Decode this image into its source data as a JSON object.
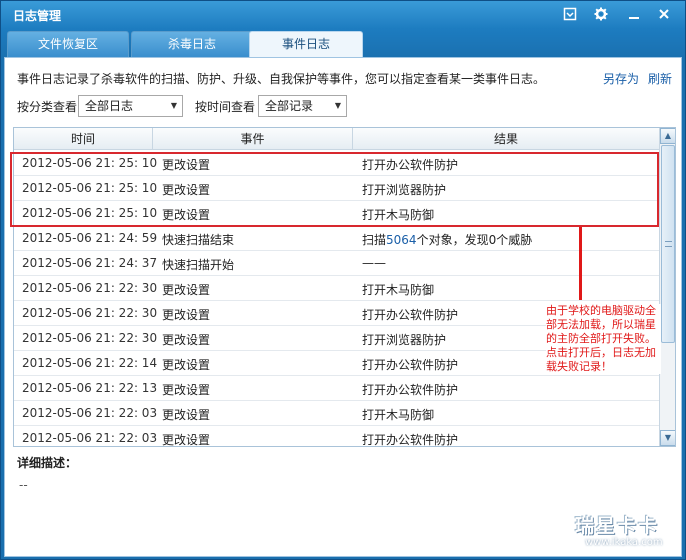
{
  "window": {
    "title": "日志管理"
  },
  "tabs": [
    {
      "label": "文件恢复区",
      "active": false
    },
    {
      "label": "杀毒日志",
      "active": false
    },
    {
      "label": "事件日志",
      "active": true
    }
  ],
  "header": {
    "description": "事件日志记录了杀毒软件的扫描、防护、升级、自我保护等事件，您可以指定查看某一类事件日志。",
    "save_as": "另存为",
    "refresh": "刷新"
  },
  "filters": {
    "category_label": "按分类查看",
    "category_value": "全部日志",
    "time_label": "按时间查看",
    "time_value": "全部记录"
  },
  "table": {
    "columns": [
      "时间",
      "事件",
      "结果"
    ],
    "rows": [
      {
        "time": "2012-05-06 21: 25: 10",
        "event": "更改设置",
        "result": "打开办公软件防护"
      },
      {
        "time": "2012-05-06 21: 25: 10",
        "event": "更改设置",
        "result": "打开浏览器防护"
      },
      {
        "time": "2012-05-06 21: 25: 10",
        "event": "更改设置",
        "result": "打开木马防御"
      },
      {
        "time": "2012-05-06 21: 24: 59",
        "event": "快速扫描结束",
        "result_pre": "扫描",
        "result_num": "5064",
        "result_post": "个对象，发现0个威胁"
      },
      {
        "time": "2012-05-06 21: 24: 37",
        "event": "快速扫描开始",
        "result": "——"
      },
      {
        "time": "2012-05-06 21: 22: 30",
        "event": "更改设置",
        "result": "打开木马防御"
      },
      {
        "time": "2012-05-06 21: 22: 30",
        "event": "更改设置",
        "result": "打开办公软件防护"
      },
      {
        "time": "2012-05-06 21: 22: 30",
        "event": "更改设置",
        "result": "打开浏览器防护"
      },
      {
        "time": "2012-05-06 21: 22: 14",
        "event": "更改设置",
        "result": "打开办公软件防护"
      },
      {
        "time": "2012-05-06 21: 22: 13",
        "event": "更改设置",
        "result": "打开办公软件防护"
      },
      {
        "time": "2012-05-06 21: 22: 03",
        "event": "更改设置",
        "result": "打开木马防御"
      },
      {
        "time": "2012-05-06 21: 22: 03",
        "event": "更改设置",
        "result": "打开办公软件防护"
      }
    ]
  },
  "annotation": {
    "text": "由于学校的电脑驱动全部无法加载，所以瑞星的主防全部打开失败。点击打开后，日志无加载失败记录！"
  },
  "detail": {
    "label": "详细描述：",
    "value": "--"
  },
  "watermark": {
    "logo": "瑞星卡卡",
    "url": "www.ikaka.com"
  },
  "colors": {
    "accent": "#1d7cc0",
    "highlight": "#d8282e",
    "link": "#1a5fa8"
  }
}
